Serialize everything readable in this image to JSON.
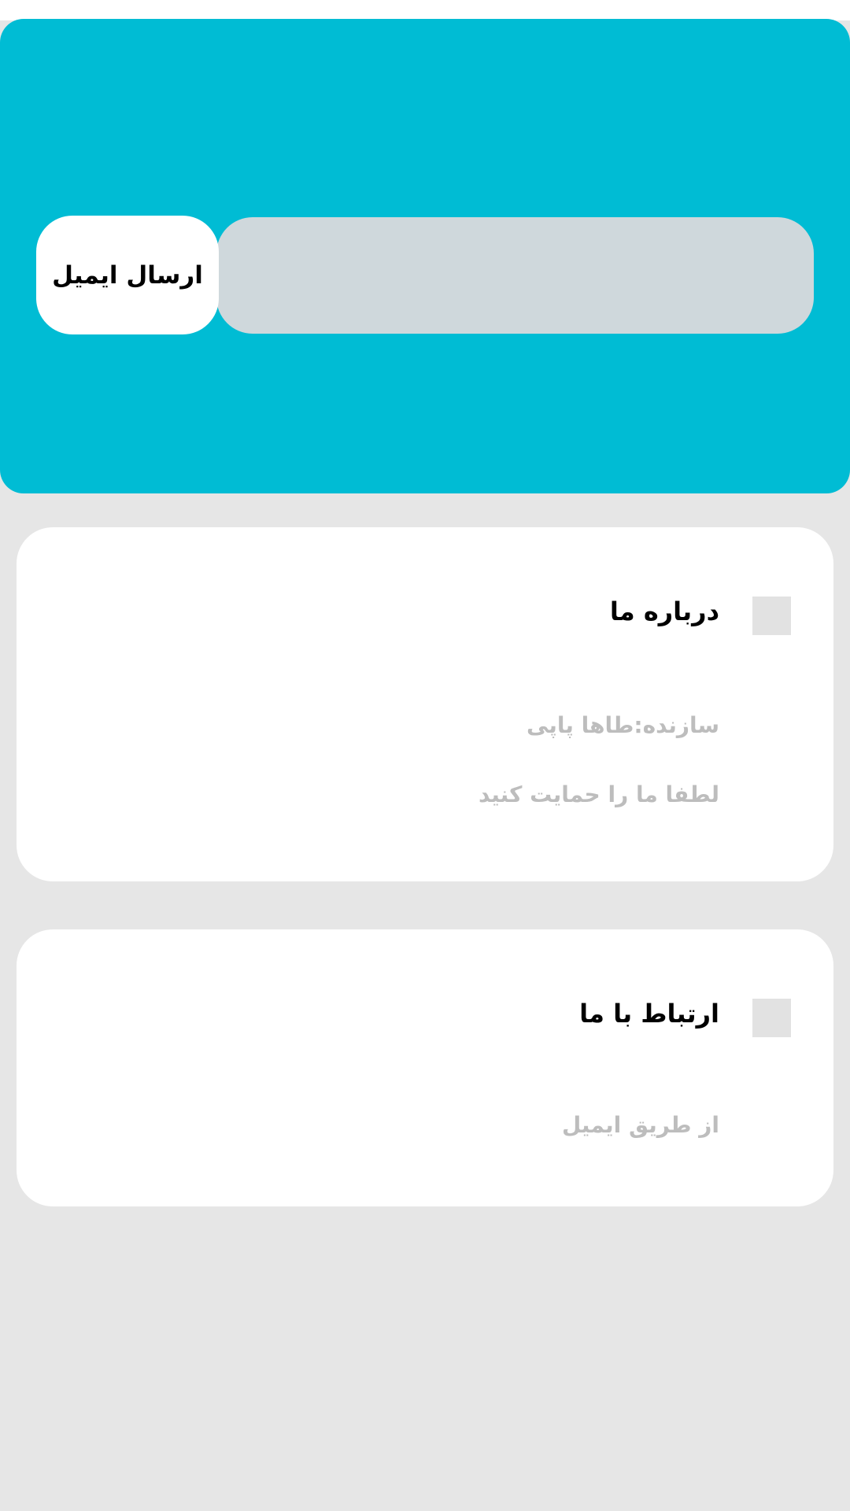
{
  "hero": {
    "send_email_label": "ارسال ایمیل",
    "email_input": {
      "value": "",
      "placeholder": ""
    }
  },
  "about": {
    "title": "درباره ما",
    "creator": "سازنده:طاها پاپی",
    "support": "لطفا ما را حمایت کنید"
  },
  "contact": {
    "title": "ارتباط با ما",
    "via_email": "از طریق ایمیل"
  },
  "colors": {
    "accent": "#00bcd4",
    "input_bg": "#cfd8dc",
    "page_bg": "#e6e6e6",
    "muted_text": "#bdbdbd"
  }
}
